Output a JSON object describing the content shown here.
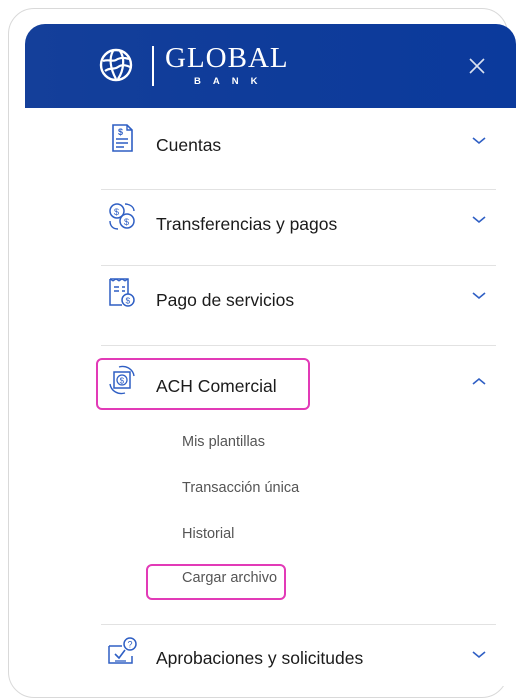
{
  "header": {
    "brand_name": "GLOBAL",
    "brand_sub": "BANK",
    "close_label": "×"
  },
  "colors": {
    "header_blue": "#0f3c9a",
    "icon_blue": "#2f5fc4",
    "highlight_magenta": "#e23ab7",
    "text_dark": "#1b1b1b",
    "text_sub": "#555555"
  },
  "menu": {
    "items": [
      {
        "label": "Cuentas",
        "icon": "statement-icon",
        "expanded": false
      },
      {
        "label": "Transferencias y pagos",
        "icon": "money-transfer-icon",
        "expanded": false
      },
      {
        "label": "Pago de servicios",
        "icon": "bill-payment-icon",
        "expanded": false
      },
      {
        "label": "ACH Comercial",
        "icon": "ach-cycle-icon",
        "expanded": true,
        "subitems": [
          "Mis plantillas",
          "Transacción única",
          "Historial",
          "Cargar archivo"
        ]
      },
      {
        "label": "Aprobaciones y solicitudes",
        "icon": "approval-icon",
        "expanded": false
      }
    ]
  }
}
